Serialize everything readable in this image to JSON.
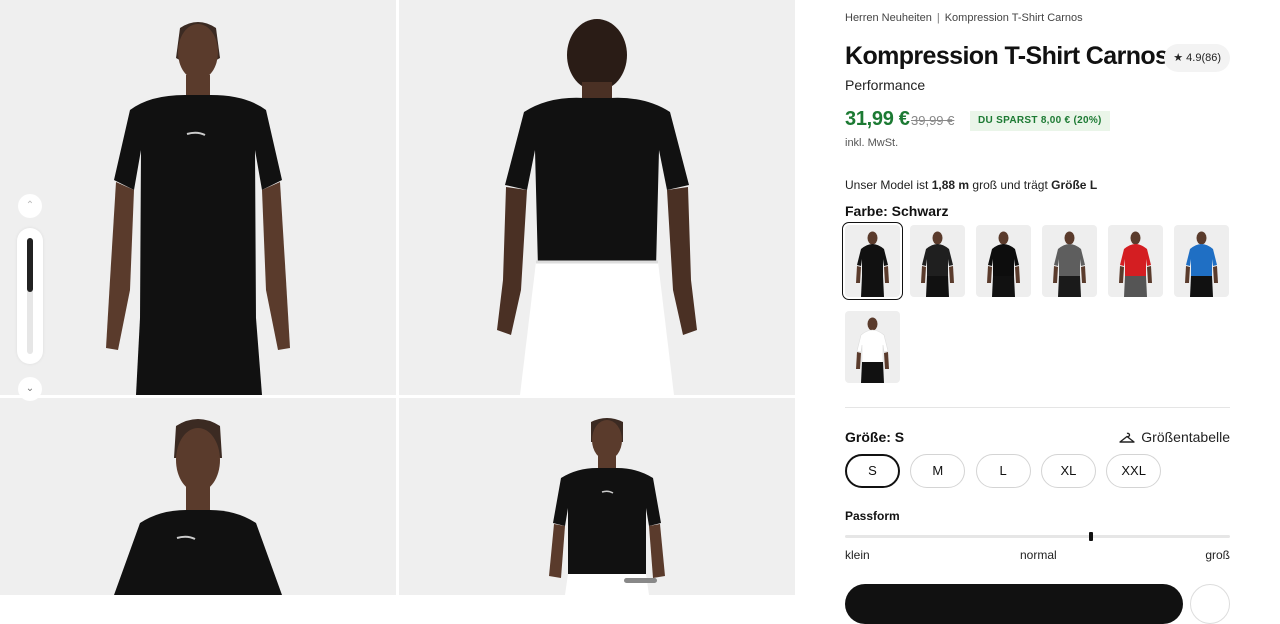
{
  "breadcrumb": [
    "Herren Neuheiten",
    "Kompression T-Shirt Carnos"
  ],
  "breadcrumb_separator": "|",
  "product": {
    "title": "Kompression T-Shirt Carnos",
    "subtitle": "Performance",
    "rating": "4.9",
    "review_count": "(86)",
    "price": "31,99 €",
    "old_price": "39,99 €",
    "savings": "DU SPARST 8,00 € (20%)",
    "vat_note": "inkl. MwSt."
  },
  "model_info": {
    "prefix": "Unser Model ist",
    "height": "1,88 m",
    "middle": "groß und trägt",
    "size": "Größe L"
  },
  "color": {
    "label": "Farbe: Schwarz",
    "swatches": [
      {
        "name": "Schwarz",
        "shirt": "#111111",
        "pants": "#111111",
        "selected": true
      },
      {
        "name": "Schwarz Grau",
        "shirt": "#1f1f1f",
        "pants": "#111111",
        "selected": false
      },
      {
        "name": "Schwarz 2",
        "shirt": "#0d0d0d",
        "pants": "#111111",
        "selected": false
      },
      {
        "name": "Grau",
        "shirt": "#5e5e5e",
        "pants": "#1a1a1a",
        "selected": false
      },
      {
        "name": "Rot",
        "shirt": "#d41e22",
        "pants": "#555555",
        "selected": false
      },
      {
        "name": "Blau",
        "shirt": "#1f6fc4",
        "pants": "#111111",
        "selected": false
      },
      {
        "name": "Weiß",
        "shirt": "#ffffff",
        "pants": "#111111",
        "selected": false
      }
    ]
  },
  "size": {
    "label": "Größe: S",
    "chart_link": "Größentabelle",
    "options": [
      "S",
      "M",
      "L",
      "XL",
      "XXL"
    ],
    "selected": "S"
  },
  "fit": {
    "label": "Passform",
    "ticks": [
      "klein",
      "normal",
      "groß"
    ],
    "value_fraction": 0.64
  },
  "colors": {
    "price_green": "#1c7a33",
    "savings_bg": "#eaf5e9",
    "gallery_bg": "#efefef",
    "shirt_black": "#111111",
    "pants_white": "#ffffff"
  },
  "icons": [
    "star-icon",
    "chevron-up-icon",
    "chevron-down-icon",
    "hanger-icon"
  ]
}
